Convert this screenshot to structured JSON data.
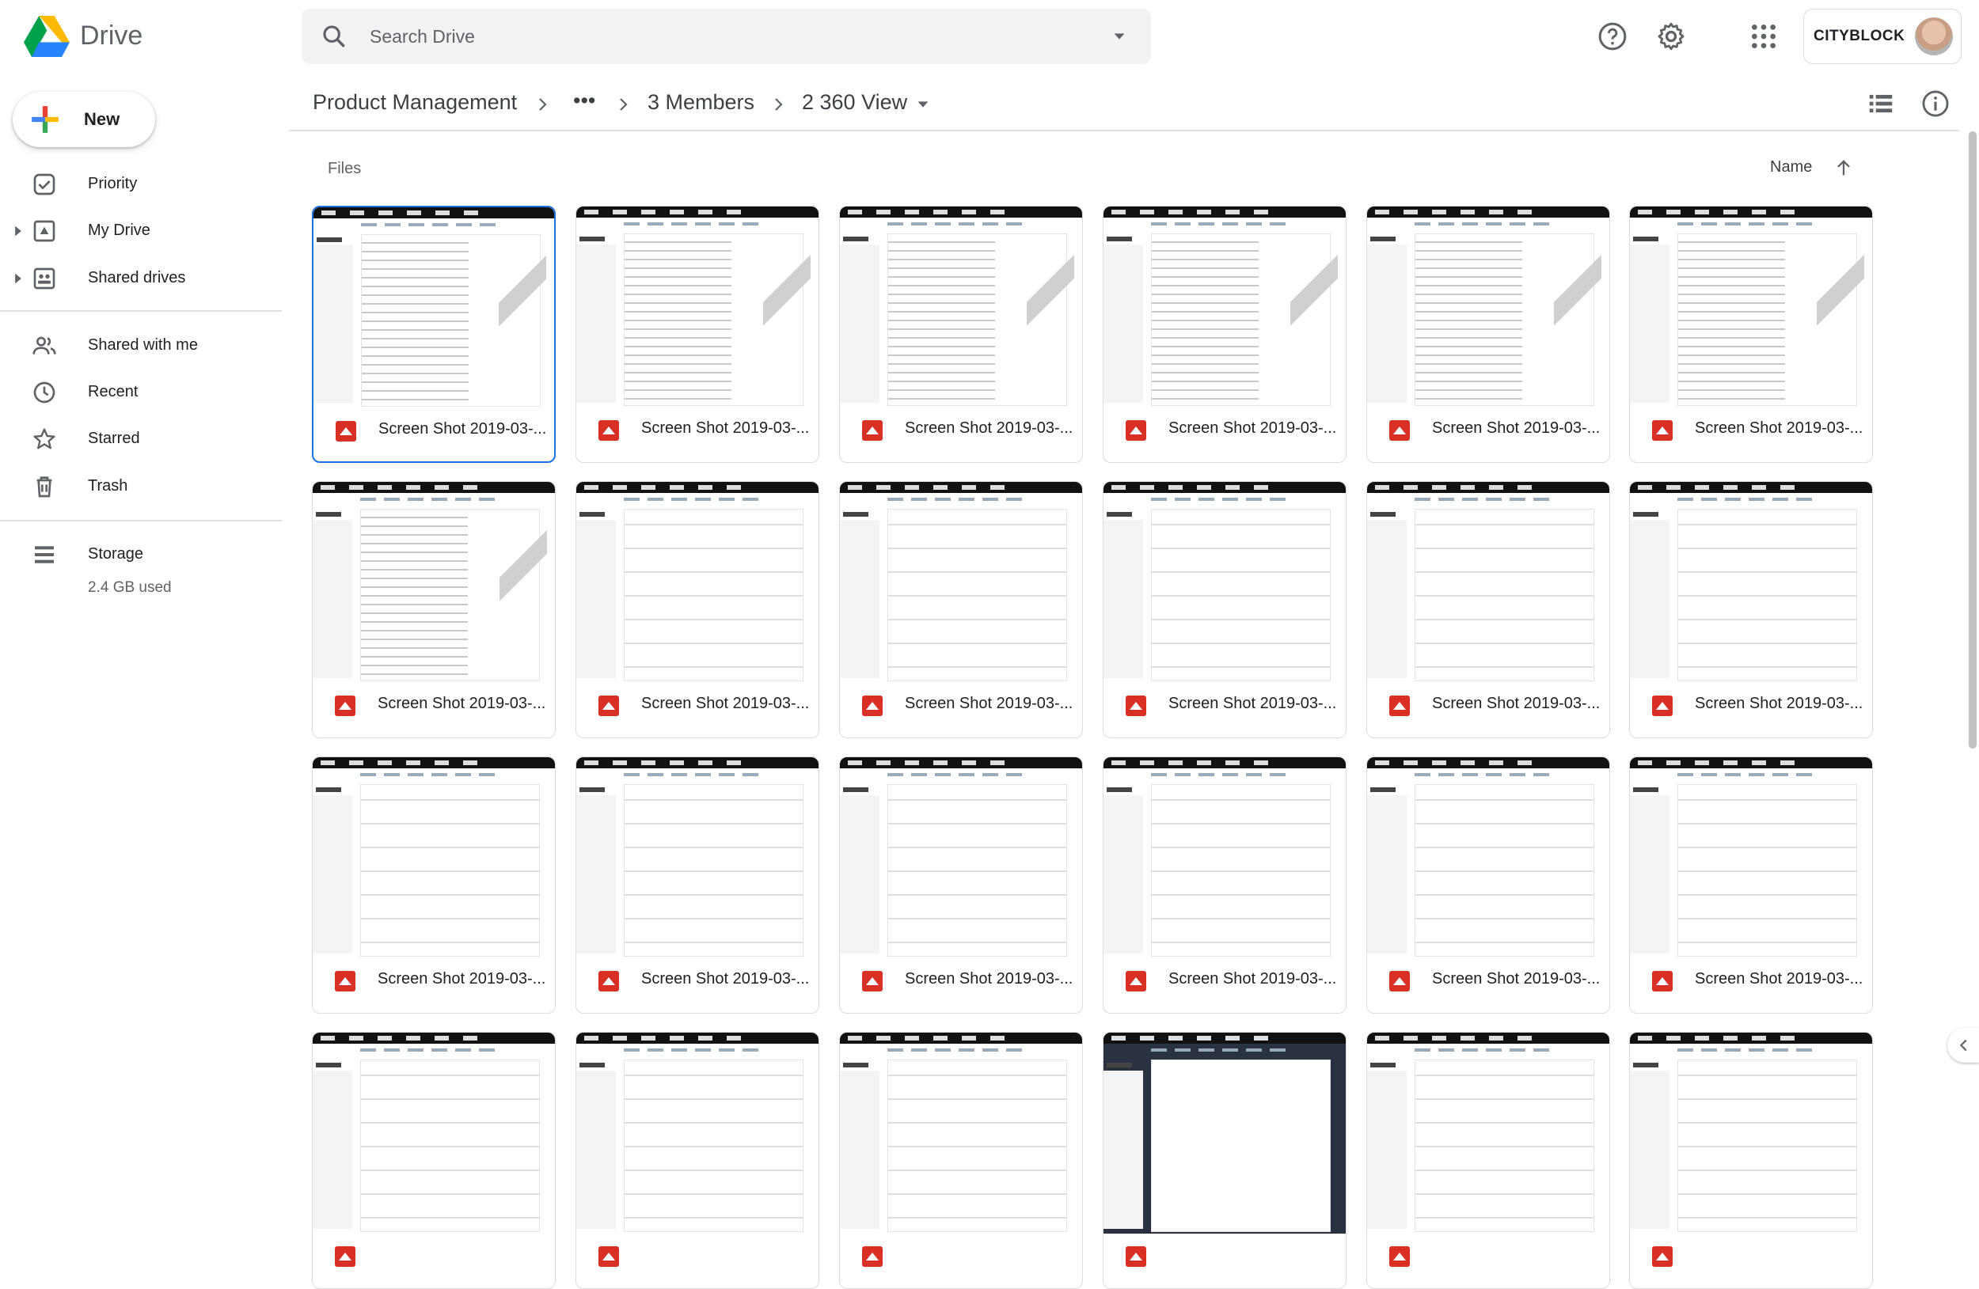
{
  "app": {
    "name": "Drive"
  },
  "search": {
    "placeholder": "Search Drive"
  },
  "header": {
    "account_label": "CITYBLOCK",
    "icons": [
      "help-icon",
      "settings-icon",
      "apps-grid-icon"
    ]
  },
  "sidebar": {
    "new_label": "New",
    "items": [
      {
        "label": "Priority",
        "icon": "priority-checkbox-icon"
      },
      {
        "label": "My Drive",
        "icon": "my-drive-icon",
        "expandable": true
      },
      {
        "label": "Shared drives",
        "icon": "shared-drives-icon",
        "expandable": true
      },
      {
        "label": "Shared with me",
        "icon": "shared-with-me-icon"
      },
      {
        "label": "Recent",
        "icon": "clock-icon"
      },
      {
        "label": "Starred",
        "icon": "star-icon"
      },
      {
        "label": "Trash",
        "icon": "trash-icon"
      }
    ],
    "storage": {
      "label": "Storage",
      "used": "2.4 GB used"
    }
  },
  "breadcrumb": {
    "items": [
      "Product Management",
      "•••",
      "3 Members",
      "2 360 View"
    ]
  },
  "main": {
    "section_label": "Files",
    "sort_label": "Name",
    "sort_direction": "ascending",
    "view_icons": [
      "list-view-icon",
      "info-icon"
    ]
  },
  "files": [
    {
      "name": "Screen Shot 2019-03-...",
      "thumb": "chart",
      "selected": true
    },
    {
      "name": "Screen Shot 2019-03-...",
      "thumb": "chart"
    },
    {
      "name": "Screen Shot 2019-03-...",
      "thumb": "chart"
    },
    {
      "name": "Screen Shot 2019-03-...",
      "thumb": "chart"
    },
    {
      "name": "Screen Shot 2019-03-...",
      "thumb": "chart"
    },
    {
      "name": "Screen Shot 2019-03-...",
      "thumb": "chart"
    },
    {
      "name": "Screen Shot 2019-03-...",
      "thumb": "chart"
    },
    {
      "name": "Screen Shot 2019-03-...",
      "thumb": "form"
    },
    {
      "name": "Screen Shot 2019-03-...",
      "thumb": "form"
    },
    {
      "name": "Screen Shot 2019-03-...",
      "thumb": "form"
    },
    {
      "name": "Screen Shot 2019-03-...",
      "thumb": "form"
    },
    {
      "name": "Screen Shot 2019-03-...",
      "thumb": "form"
    },
    {
      "name": "Screen Shot 2019-03-...",
      "thumb": "form"
    },
    {
      "name": "Screen Shot 2019-03-...",
      "thumb": "form"
    },
    {
      "name": "Screen Shot 2019-03-...",
      "thumb": "form"
    },
    {
      "name": "Screen Shot 2019-03-...",
      "thumb": "form"
    },
    {
      "name": "Screen Shot 2019-03-...",
      "thumb": "form"
    },
    {
      "name": "Screen Shot 2019-03-...",
      "thumb": "form"
    },
    {
      "name": "",
      "thumb": "form"
    },
    {
      "name": "",
      "thumb": "form"
    },
    {
      "name": "",
      "thumb": "form"
    },
    {
      "name": "",
      "thumb": "dark"
    },
    {
      "name": "",
      "thumb": "form"
    },
    {
      "name": "",
      "thumb": "form"
    }
  ],
  "colors": {
    "accent": "#1a73e8",
    "file_icon": "#d93025",
    "search_bg": "#f1f3f4"
  }
}
